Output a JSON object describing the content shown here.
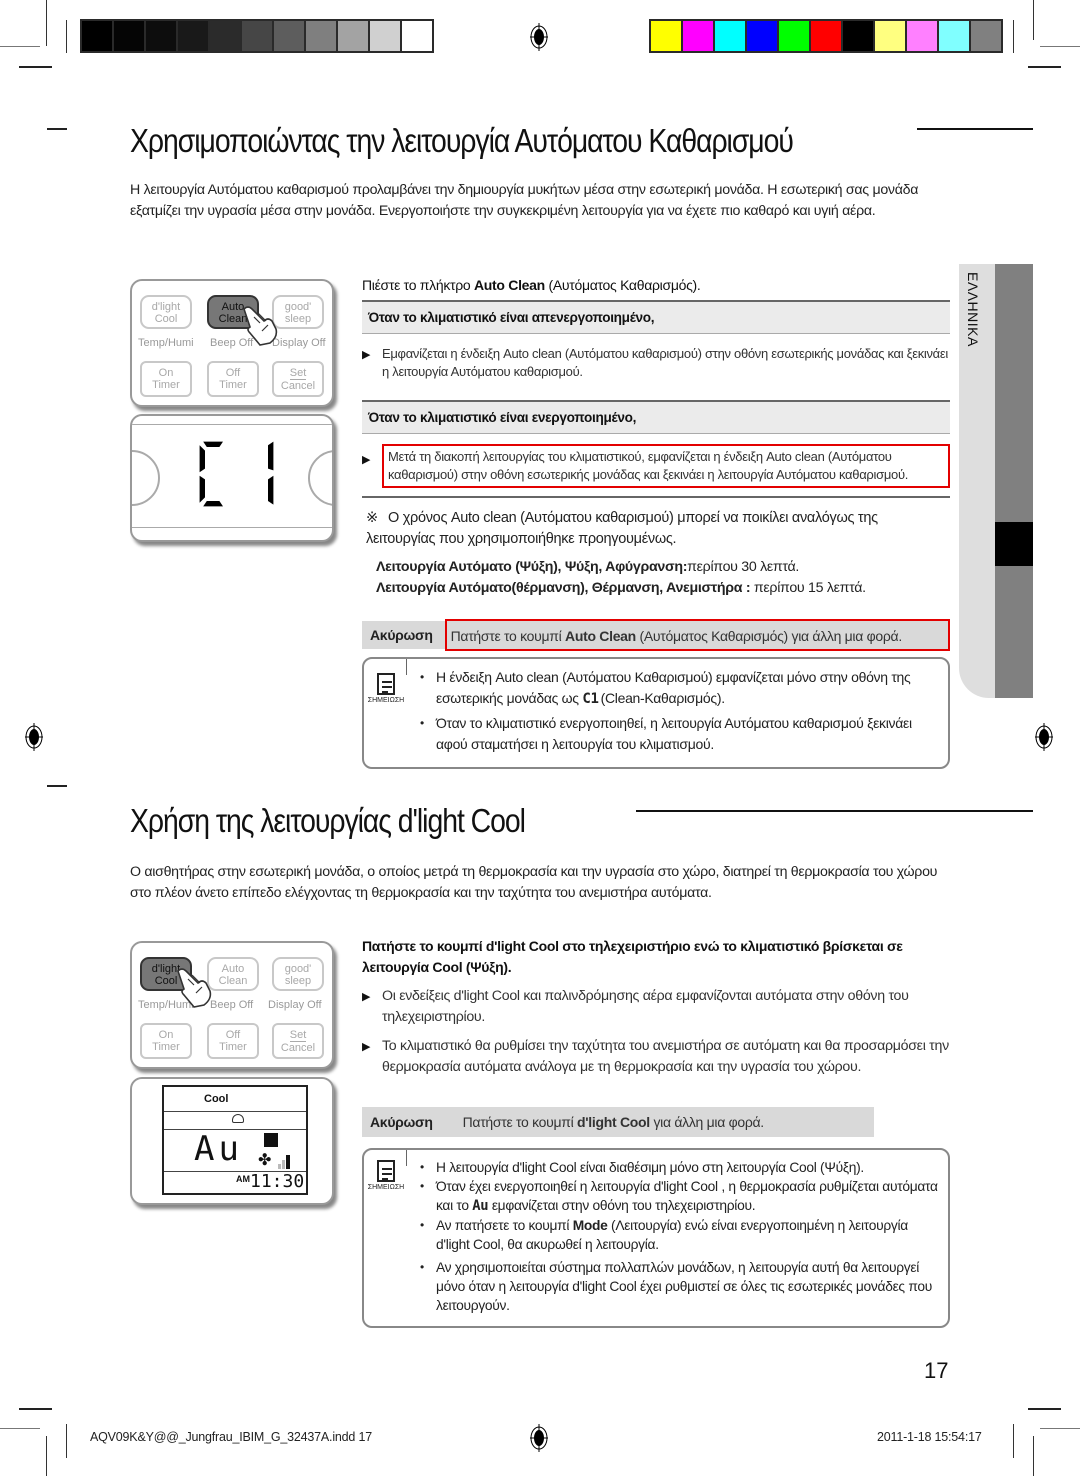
{
  "print_marks": {
    "gray_swatches": [
      "#000000",
      "#050505",
      "#0d0d0d",
      "#191919",
      "#2b2b2b",
      "#464646",
      "#5d5d5d",
      "#7f7f7f",
      "#a3a3a3",
      "#d0d0d0",
      "#ffffff"
    ],
    "color_swatches": [
      "#ffff00",
      "#ff00ff",
      "#00ffff",
      "#0000ff",
      "#00ff00",
      "#ff0000",
      "#000000",
      "#ffff80",
      "#ff80ff",
      "#80ffff",
      "#808080"
    ]
  },
  "section1": {
    "title": "Χρησιμοποιώντας την λειτουργία Αυτόματου Καθαρισμού",
    "intro": "Η λειτουργία Αυτόματου καθαρισμού προλαμβάνει την δημιουργία μυκήτων μέσα στην εσωτερική μονάδα. Η εσωτερική σας μονάδα εξατμίζει την υγρασία μέσα στην μονάδα. Ενεργοποιήστε την συγκεκριμένη λειτουργία για να έχετε πιο καθαρό και υγιή αέρα.",
    "remote": {
      "buttons": [
        {
          "line1": "d'light",
          "line2": "Cool",
          "active": false
        },
        {
          "line1": "Auto",
          "line2": "Clean",
          "active": true
        },
        {
          "line1": "good'",
          "line2": "sleep",
          "active": false
        },
        {
          "line1": "On",
          "line2": "Timer",
          "active": false
        },
        {
          "line1": "Off",
          "line2": "Timer",
          "active": false
        },
        {
          "line1": "Set",
          "line2": "Cancel",
          "active": false
        }
      ],
      "sublabels": [
        "Temp/Humi",
        "Beep Off",
        "Display Off"
      ]
    },
    "display_code": "C1",
    "step_prefix": "Πιέστε το πλήκτρο ",
    "step_bold": "Auto Clean",
    "step_suffix": " (Αυτόματος Καθαρισμός).",
    "when_off_heading": "Όταν το κλιματιστικό είναι απενεργοποιημένο,",
    "when_off_text": "Εμφανίζεται η ένδειξη Auto clean (Αυτόματου καθαρισμού) στην οθόνη εσωτερικής μονάδας και ξεκινάει η λειτουργία Αυτόματου καθαρισμού.",
    "when_on_heading": "Όταν το κλιματιστικό είναι ενεργοποιημένο,",
    "when_on_text": "Μετά τη διακοπή λειτουργίας του κλιματιστικού, εμφανίζεται η ένδειξη Auto clean (Αυτόματου καθαρισμού) στην οθόνη εσωτερικής μονάδας και ξεκινάει η λειτουργία Αυτόματου καθαρισμού.",
    "note_mark": "※",
    "time_note": "Ο χρόνος Auto clean (Αυτόματου καθαρισμού) μπορεί να ποικίλει αναλόγως της λειτουργίας που χρησιμοποιήθηκε προηγουμένως.",
    "time_line1_bold": "Λειτουργία Αυτόματο (Ψύξη), Ψύξη, Αφύγρανση:",
    "time_line1_rest": "περίπου 30 λεπτά.",
    "time_line2_bold": "Λειτουργία Αυτόματο(θέρμανση), Θέρμανση, Ανεμιστήρα : ",
    "time_line2_rest": "περίπου 15 λεπτά.",
    "cancel_label": "Ακύρωση",
    "cancel_prefix": "Πατήστε το κουμπί ",
    "cancel_bold": "Auto Clean",
    "cancel_suffix": " (Αυτόματος Καθαρισμός) για άλλη μια φορά.",
    "note_caption": "ΣΗΜΕΙΩΣΗ",
    "notes": [
      {
        "pre": "Η ένδειξη Auto clean (Αυτόματου Καθαρισμού) εμφανίζεται μόνο στην οθόνη της εσωτερικής μονάδας ως ",
        "glyph": "C1",
        "post": "(Clean-Καθαρισμός)."
      },
      {
        "pre": "Όταν το κλιματιστικό ενεργοποιηθεί, η λειτουργία Αυτόματου καθαρισμού ξεκινάει αφού σταματήσει η λειτουργία του κλιματισμού.",
        "glyph": "",
        "post": ""
      }
    ]
  },
  "side_tab": {
    "label": "ΕΛΛΗΝΙΚΑ"
  },
  "section2": {
    "title": "Χρήση της λειτουργίας d'light Cool",
    "intro": "Ο αισθητήρας στην εσωτερική μονάδα, ο οποίος μετρά τη θερμοκρασία και την υγρασία στο χώρο, διατηρεί τη θερμοκρασία του χώρου στο πλέον άνετο επίπεδο ελέγχοντας τη θερμοκρασία και την ταχύτητα του ανεμιστήρα αυτόματα.",
    "remote": {
      "buttons": [
        {
          "line1": "d'light",
          "line2": "Cool",
          "active": true
        },
        {
          "line1": "Auto",
          "line2": "Clean",
          "active": false
        },
        {
          "line1": "good'",
          "line2": "sleep",
          "active": false
        },
        {
          "line1": "On",
          "line2": "Timer",
          "active": false
        },
        {
          "line1": "Off",
          "line2": "Timer",
          "active": false
        },
        {
          "line1": "Set",
          "line2": "Cancel",
          "active": false
        }
      ],
      "sublabels": [
        "Temp/Humi",
        "Beep Off",
        "Display Off"
      ]
    },
    "lcd": {
      "mode": "Cool",
      "value": "Au",
      "ampm": "AM",
      "time": "11:30"
    },
    "step_a": "Πατήστε το κουμπί ",
    "step_bold": "d'light Cool",
    "step_b": " στο τηλεχειριστήριο ενώ το κλιματιστικό βρίσκεται σε λειτουργία Cool (Ψύξη).",
    "bullets": [
      "Οι ενδείξεις d'light Cool και παλινδρόμησης αέρα εμφανίζονται αυτόματα στην οθόνη του τηλεχειριστηρίου.",
      "Το κλιματιστικό θα ρυθμίσει την ταχύτητα του ανεμιστήρα σε αυτόματη και θα προσαρμόσει την θερμοκρασία αυτόματα ανάλογα με τη θερμοκρασία και την υγρασία του χώρου."
    ],
    "cancel_label": "Ακύρωση",
    "cancel_prefix": "Πατήστε το κουμπί ",
    "cancel_bold": "d'light Cool",
    "cancel_suffix": " για άλλη μια φορά.",
    "note_caption": "ΣΗΜΕΙΩΣΗ",
    "notes": {
      "n1": "Η λειτουργία d'light Cool είναι διαθέσιμη μόνο στη λειτουργία Cool (Ψύξη).",
      "n2_pre": "Όταν έχει ενεργοποιηθεί η λειτουργία d'light Cool , η θερμοκρασία ρυθμίζεται αυτόματα και το ",
      "n2_glyph": "Au",
      "n2_post": " εμφανίζεται στην οθόνη του τηλεχειριστηρίου.",
      "n3_pre": "Αν πατήσετε το κουμπί ",
      "n3_bold": "Mode",
      "n3_post": " (Λειτουργία) ενώ είναι ενεργοποιημένη η λειτουργία d'light Cool, θα ακυρωθεί η λειτουργία.",
      "n4": "Αν χρησιμοποιείται σύστημα πολλαπλών μονάδων, η λειτουργία αυτή θα λειτουργεί μόνο όταν η λειτουργία d'light Cool έχει ρυθμιστεί σε όλες τις εσωτερικές μονάδες που λειτουργούν."
    }
  },
  "page_number": "17",
  "footer": {
    "file": "AQV09K&Y@@_Jungfrau_IBIM_G_32437A.indd   17",
    "timestamp": "2011-1-18   15:54:17"
  },
  "colors": {
    "highlight_red": "#e30000",
    "grey_band": "#ebebeb",
    "cancel_band": "#d9d9d9",
    "tab_dark": "#808080",
    "tab_light": "#dedede"
  }
}
